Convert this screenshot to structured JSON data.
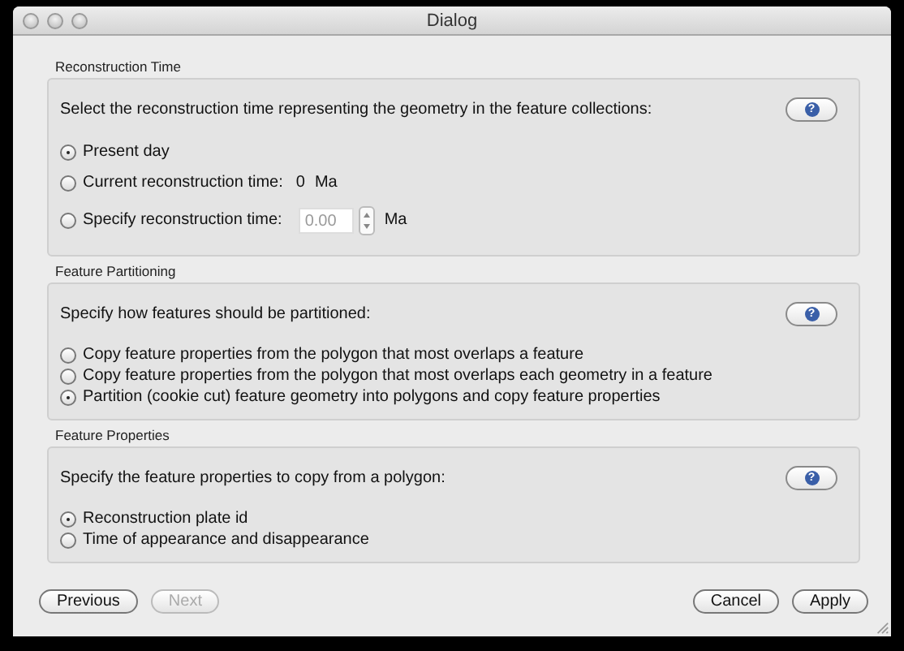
{
  "window": {
    "title": "Dialog"
  },
  "sections": [
    {
      "title": "Reconstruction Time",
      "prompt": "Select the reconstruction time representing the geometry in the feature collections:",
      "help": "?",
      "options": [
        {
          "kind": "plain",
          "label": "Present day",
          "selected": true
        },
        {
          "kind": "value",
          "label": "Current reconstruction time:",
          "value": "0",
          "unit": "Ma",
          "selected": false
        },
        {
          "kind": "spin",
          "label": "Specify reconstruction time:",
          "value": "0.00",
          "unit": "Ma",
          "disabled": true,
          "selected": false
        }
      ]
    },
    {
      "title": "Feature Partitioning",
      "prompt": "Specify how features should be partitioned:",
      "help": "?",
      "options": [
        {
          "kind": "plain",
          "label": "Copy feature properties from the polygon that most overlaps a feature",
          "selected": false
        },
        {
          "kind": "plain",
          "label": "Copy feature properties from the polygon that most overlaps each geometry in a feature",
          "selected": false
        },
        {
          "kind": "plain",
          "label": "Partition (cookie cut) feature geometry into polygons and copy feature properties",
          "selected": true
        }
      ]
    },
    {
      "title": "Feature Properties",
      "prompt": "Specify the feature properties to copy from a polygon:",
      "help": "?",
      "options": [
        {
          "kind": "plain",
          "label": "Reconstruction plate id",
          "selected": true
        },
        {
          "kind": "plain",
          "label": "Time of appearance and disappearance",
          "selected": false
        }
      ]
    }
  ],
  "buttons_left": [
    {
      "label": "Previous",
      "disabled": false
    },
    {
      "label": "Next",
      "disabled": true
    }
  ],
  "buttons_right": [
    {
      "label": "Cancel",
      "disabled": false
    },
    {
      "label": "Apply",
      "disabled": false
    }
  ]
}
